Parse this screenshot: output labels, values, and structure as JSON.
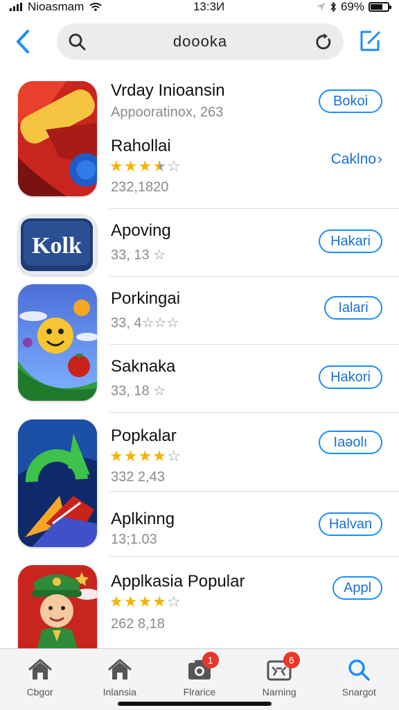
{
  "status_bar": {
    "carrier": "Nioasmam",
    "time": "13:3И",
    "battery": "69%",
    "battery_level": 0.69
  },
  "search": {
    "query": "doooka"
  },
  "apps": [
    {
      "name": "Vrday Inioansin",
      "subtitle": "Appooratinox, 263",
      "button": "Bokoi",
      "icon": "red-yellow-abstract-icon"
    },
    {
      "name": "Rahollai",
      "rating": 3.5,
      "subtitle": "232,1820",
      "button": "Caklno",
      "button_chevron": "›"
    },
    {
      "name": "Apoving",
      "subtitle": "33, 13 ☆",
      "button": "Hakari",
      "icon": "kolk-icon",
      "icon_text": "Kolk"
    },
    {
      "name": "Porkingai",
      "subtitle": "33, 4☆☆☆",
      "button": "Ialari",
      "icon": "smiley-game-icon"
    },
    {
      "name": "Saknaka",
      "subtitle": "33, 18 ☆",
      "button": "Hakori"
    },
    {
      "name": "Popkalar",
      "rating": 4,
      "subtitle": "332 2,43",
      "button": "Iaəolı",
      "icon": "green-arrow-icon"
    },
    {
      "name": "Aplkinng",
      "subtitle": "13;1.03",
      "button": "Halvan"
    },
    {
      "name": "Applkasia Popular",
      "rating": 4,
      "subtitle": "262 8,18",
      "button": "Appl",
      "icon": "boy-character-icon"
    }
  ],
  "tabs": [
    {
      "label": "Cbgor",
      "icon": "home-icon"
    },
    {
      "label": "Inlansia",
      "icon": "home-icon"
    },
    {
      "label": "Flrarice",
      "icon": "camera-icon",
      "badge": "1"
    },
    {
      "label": "Narning",
      "icon": "game-icon",
      "badge": "6"
    },
    {
      "label": "Snargot",
      "icon": "search-icon"
    }
  ],
  "colors": {
    "accent": "#1a70d8",
    "star": "#f4b400",
    "badge": "#e8372b"
  }
}
